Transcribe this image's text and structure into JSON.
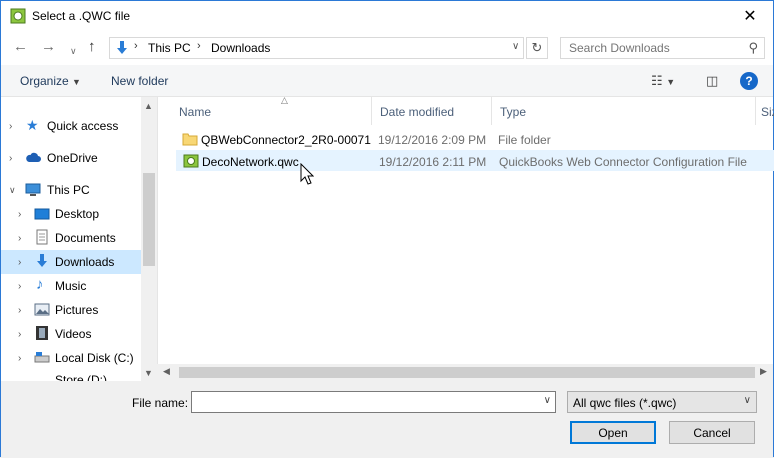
{
  "window": {
    "title": "Select a .QWC file",
    "close_glyph": "✕"
  },
  "address": {
    "segments": [
      "This PC",
      "Downloads"
    ],
    "search_placeholder": "Search Downloads"
  },
  "toolbar": {
    "organize": "Organize",
    "new_folder": "New folder",
    "help": "?"
  },
  "nav": {
    "items": [
      {
        "label": "Quick access",
        "icon": "star-icon"
      },
      {
        "label": "OneDrive",
        "icon": "cloud-icon"
      },
      {
        "label": "This PC",
        "icon": "computer-icon"
      },
      {
        "label": "Desktop",
        "icon": "desktop-icon"
      },
      {
        "label": "Documents",
        "icon": "documents-icon"
      },
      {
        "label": "Downloads",
        "icon": "download-icon"
      },
      {
        "label": "Music",
        "icon": "music-icon"
      },
      {
        "label": "Pictures",
        "icon": "pictures-icon"
      },
      {
        "label": "Videos",
        "icon": "videos-icon"
      },
      {
        "label": "Local Disk (C:)",
        "icon": "disk-icon"
      },
      {
        "label": "Store (D:)",
        "icon": "disk-icon"
      }
    ]
  },
  "columns": {
    "name": "Name",
    "date": "Date modified",
    "type": "Type",
    "size": "Siz"
  },
  "files": [
    {
      "name": "QBWebConnector2_2R0-00071",
      "date": "19/12/2016 2:09 PM",
      "type": "File folder",
      "icon": "folder-icon"
    },
    {
      "name": "DecoNetwork.qwc",
      "date": "19/12/2016 2:11 PM",
      "type": "QuickBooks Web Connector Configuration File",
      "icon": "qwc-file-icon"
    }
  ],
  "bottom": {
    "file_name_label": "File name:",
    "file_name_value": "",
    "filter": "All qwc files (*.qwc)",
    "open": "Open",
    "cancel": "Cancel"
  }
}
